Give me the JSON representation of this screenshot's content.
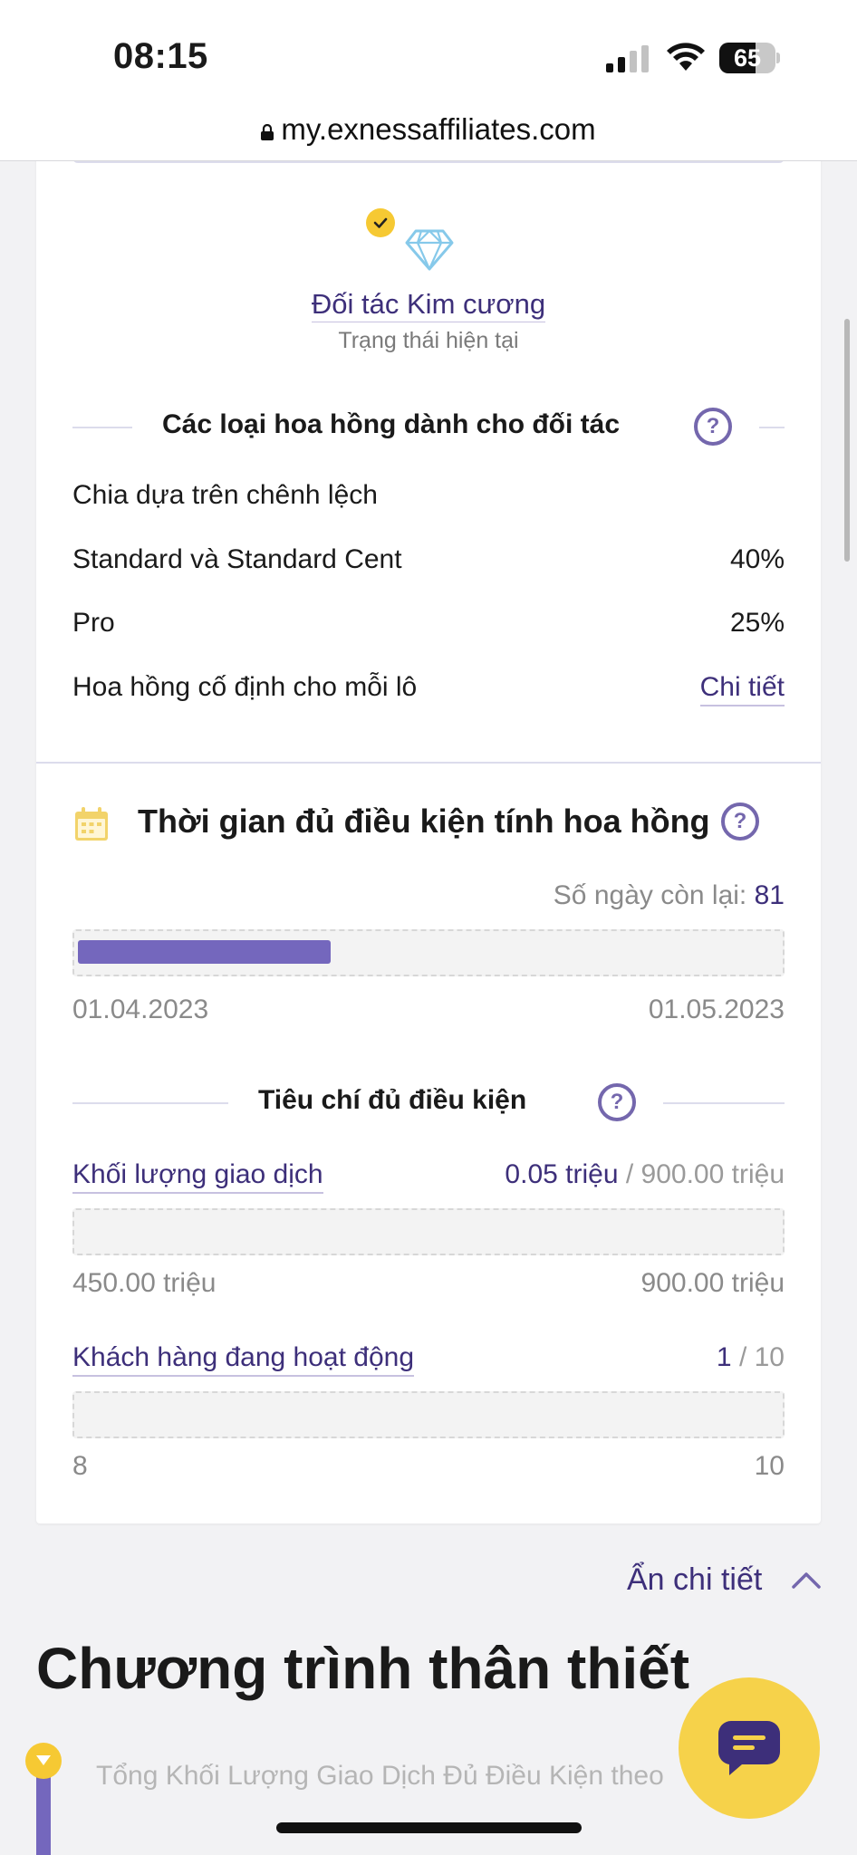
{
  "status_bar": {
    "time": "08:15",
    "battery": "65",
    "battery_level": 0.65,
    "icons": [
      "cellular-signal-icon",
      "wifi-icon",
      "battery-icon"
    ]
  },
  "url_bar": {
    "url": "my.exnessaffiliates.com",
    "icon": "lock-icon"
  },
  "partner_status": {
    "tier": "Đối tác Kim cương",
    "status_label": "Trạng thái hiện tại",
    "icons": [
      "check-badge-icon",
      "diamond-icon"
    ]
  },
  "commission_types": {
    "title": "Các loại hoa hồng dành cho đối tác",
    "spread_share_label": "Chia dựa trên chênh lệch",
    "rows": [
      {
        "label": "Standard và Standard Cent",
        "value": "40%"
      },
      {
        "label": "Pro",
        "value": "25%"
      }
    ],
    "fixed_label": "Hoa hồng cố định cho mỗi lô",
    "fixed_link": "Chi tiết"
  },
  "qualification_period": {
    "title": "Thời gian đủ điều kiện tính hoa hồng",
    "days_left_label": "Số ngày còn lại:",
    "days_left_value": "81",
    "progress": 0.36,
    "start_date": "01.04.2023",
    "end_date": "01.05.2023"
  },
  "criteria": {
    "title": "Tiêu chí đủ điều kiện",
    "trading_volume": {
      "label": "Khối lượng giao dịch",
      "current": "0.05 triệu",
      "separator": "/",
      "target": "900.00 triệu",
      "range_min": "450.00 triệu",
      "range_max": "900.00 triệu",
      "progress": 0
    },
    "active_clients": {
      "label": "Khách hàng đang hoạt động",
      "current": "1",
      "separator": "/",
      "target": "10",
      "range_min": "8",
      "range_max": "10",
      "progress": 0
    }
  },
  "hide_details": "Ẩn chi tiết",
  "loyalty": {
    "title": "Chương trình thân thiết",
    "subtitle": "Tổng Khối Lượng Giao Dịch Đủ Điều Kiện theo"
  },
  "colors": {
    "accent": "#7467bd",
    "link": "#3d2f7a",
    "badge_yellow": "#f6c933",
    "chat_button": "#f6d24a"
  }
}
